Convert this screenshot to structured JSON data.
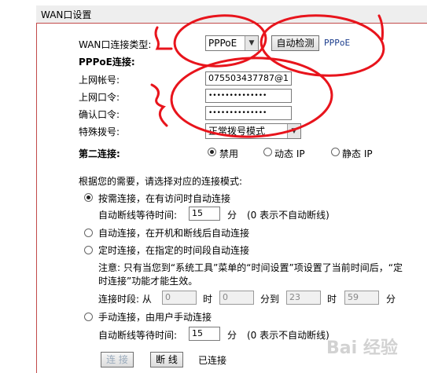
{
  "title": "WAN口设置",
  "wan_type": {
    "label": "WAN口连接类型:",
    "selected": "PPPoE",
    "detect_button": "自动检测",
    "detected": "PPPoE"
  },
  "pppoe_heading": "PPPoE连接:",
  "account": {
    "label": "上网帐号:",
    "value": "075503437787@1"
  },
  "password": {
    "label": "上网口令:",
    "value": "••••••••••••••"
  },
  "confirm": {
    "label": "确认口令:",
    "value": "••••••••••••••"
  },
  "dial": {
    "label": "特殊拨号:",
    "selected": "正常拨号模式"
  },
  "second": {
    "label": "第二连接:",
    "options": [
      "禁用",
      "动态 IP",
      "静态 IP"
    ]
  },
  "mode_prompt": "根据您的需要，请选择对应的连接模式:",
  "modes": {
    "on_demand": "按需连接，在有访问时自动连接",
    "idle_label": "自动断线等待时间:",
    "idle_value": "15",
    "idle_unit": "分",
    "idle_note": "(0 表示不自动断线)",
    "auto": "自动连接，在开机和断线后自动连接",
    "timed": "定时连接，在指定的时间段自动连接",
    "note1": "注意: 只有当您到“系统工具”菜单的“时间设置”项设置了当前时间后，“定",
    "note2": "时连接”功能才能生效。",
    "period_label": "连接时段: 从",
    "t1": "0",
    "t2": "0",
    "t3": "23",
    "t4": "59",
    "hour": "时",
    "min_to": "分到",
    "min": "分",
    "manual": "手动连接，由用户手动连接",
    "idle2_label": "自动断线等待时间:",
    "idle2_value": "15",
    "idle2_unit": "分",
    "idle2_note": "(0 表示不自动断线)"
  },
  "buttons": {
    "connect": "连 接",
    "disconnect": "断 线",
    "status": "已连接"
  },
  "watermark": "Bai 经验",
  "colors": {
    "frame": "#c24a4a",
    "annotation": "#e8141c"
  }
}
